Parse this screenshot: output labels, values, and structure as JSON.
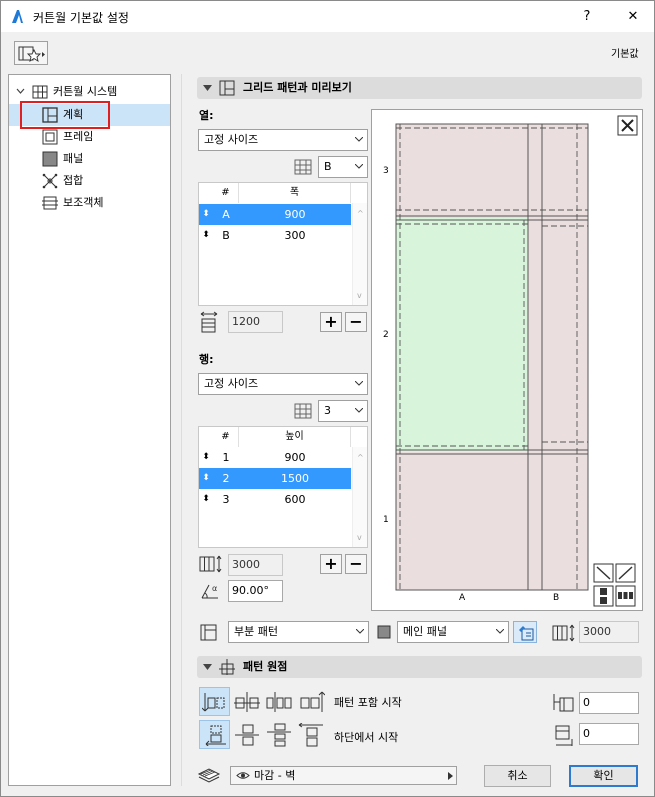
{
  "window": {
    "title": "커튼월 기본값 설정",
    "help": "?",
    "close": "✕"
  },
  "toolbar": {
    "default_label": "기본값"
  },
  "tree": {
    "root": "커튼월 시스템",
    "items": [
      {
        "label": "계획",
        "selected": true
      },
      {
        "label": "프레임"
      },
      {
        "label": "패널"
      },
      {
        "label": "접합"
      },
      {
        "label": "보조객체"
      }
    ]
  },
  "section_grid": {
    "title": "그리드 패턴과 미리보기"
  },
  "columns": {
    "label": "열:",
    "mode": "고정 사이즈",
    "count": "B",
    "headers": [
      "#",
      "폭"
    ],
    "rows": [
      {
        "id": "A",
        "value": "900",
        "selected": true
      },
      {
        "id": "B",
        "value": "300"
      }
    ],
    "total": "1200"
  },
  "rows_section": {
    "label": "행:",
    "mode": "고정 사이즈",
    "count": "3",
    "headers": [
      "#",
      "높이"
    ],
    "rows": [
      {
        "id": "1",
        "value": "900"
      },
      {
        "id": "2",
        "value": "1500",
        "selected": true
      },
      {
        "id": "3",
        "value": "600"
      }
    ],
    "total": "3000",
    "angle": "90.00°"
  },
  "preview": {
    "row_labels": [
      "3",
      "2",
      "1"
    ],
    "col_labels": [
      "A",
      "B"
    ]
  },
  "bottom_bar": {
    "pattern_type": "부분 패턴",
    "panel_type": "메인 패널",
    "height": "3000"
  },
  "section_origin": {
    "title": "패턴 원점",
    "include_start": "패턴 포함 시작",
    "bottom_start": "하단에서 시작",
    "value1": "0",
    "value2": "0"
  },
  "footer": {
    "layer": "마감 - 벽",
    "cancel": "취소",
    "ok": "확인"
  },
  "colors": {
    "selection": "#3399ff",
    "preview_panel": "#eadede",
    "preview_selected": "#d8f5dc",
    "highlight": "#e02020"
  }
}
